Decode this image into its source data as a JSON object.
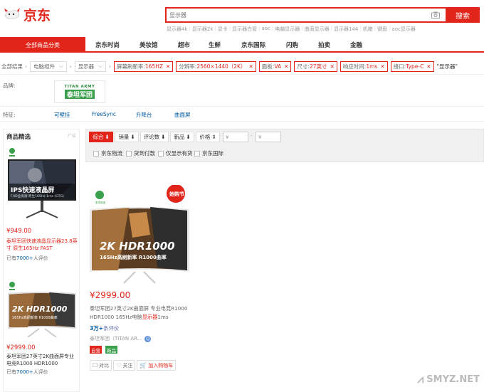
{
  "header": {
    "logo_text": "京东",
    "search_placeholder": "显示器",
    "search_button": "搜索",
    "hotwords": [
      "显示器4k",
      "显示器2k",
      "显卡",
      "显示器白管",
      "aoc",
      "电脑显示器",
      "曲面显示器",
      "显示器144",
      "机箱",
      "键盘",
      "aoc显示器"
    ]
  },
  "nav": {
    "all_categories": "全部商品分类",
    "items": [
      "京东时尚",
      "美妆馆",
      "超市",
      "生鲜",
      "京东国际",
      "闪购",
      "拍卖",
      "金融"
    ]
  },
  "crumbs": {
    "root": "全部结果",
    "level1": "电脑组件",
    "level2": "显示器",
    "filters": [
      {
        "key": "屏幕刷新率:",
        "value": "165HZ"
      },
      {
        "key": "分辨率:",
        "value": "2560×1440（2K）"
      },
      {
        "key": "面板:",
        "value": "VA"
      },
      {
        "key": "尺寸:",
        "value": "27英寸"
      },
      {
        "key": "响应时间:",
        "value": "1ms"
      },
      {
        "key": "接口:",
        "value": "Type-C"
      }
    ],
    "keyword": "\"显示器\""
  },
  "brand": {
    "label": "品牌:",
    "logo_line1": "TITAN ARMY",
    "logo_line2": "泰坦军团"
  },
  "features": {
    "label": "特征:",
    "items": [
      "可壁挂",
      "FreeSync",
      "升降台",
      "曲面屏"
    ]
  },
  "sidebar": {
    "title": "商品精选",
    "ad_label": "广告",
    "products": [
      {
        "banner": "IPS快速液晶屏",
        "banner_sub": "FHD全高清 原生165Hz 1ms (GTG)",
        "price": "¥949.00",
        "name": "泰坦军团快速液晶显示器23.8英寸 原生165Hz FAST",
        "reviews_prefix": "已有",
        "reviews_count": "7000+",
        "reviews_suffix": "人评价"
      },
      {
        "banner": "2K HDR1000",
        "banner_sub": "165Hz高刷新率 R1000曲率",
        "price": "¥2999.00",
        "name": "泰坦军团27英寸2K曲面屏专业电竞R1000 HDR1000",
        "reviews_prefix": "已有",
        "reviews_count": "7000+",
        "reviews_suffix": "人评价"
      }
    ]
  },
  "sortbar": {
    "buttons": [
      "综合",
      "销量",
      "评论数",
      "新品",
      "价格"
    ],
    "price_from": "¥",
    "price_to": "¥",
    "checks": [
      "京东物流",
      "货到付款",
      "仅显示有货",
      "京东国际"
    ]
  },
  "product": {
    "price": "¥2999.00",
    "badge": "她购节",
    "img_title": "2K HDR1000",
    "img_sub": "165Hz高刷新率 R1000曲率",
    "name_before": "泰坦军团27英寸2K曲面屏 专业电竞R1000 HDR1000 165Hz电脑",
    "name_highlight": "显示器",
    "name_after": "1ms",
    "reviews_count": "3万+",
    "reviews_suffix": "条评价",
    "shop": "泰坦军团（TITAN AR...",
    "tags": [
      "自营",
      "新品"
    ],
    "actions": [
      "对比",
      "关注",
      "加入购物车"
    ]
  },
  "watermark": "SMYZ.NET",
  "colors": {
    "brand_red": "#e1251b",
    "link_blue": "#005aa0",
    "tag_green": "#3aa04c"
  }
}
